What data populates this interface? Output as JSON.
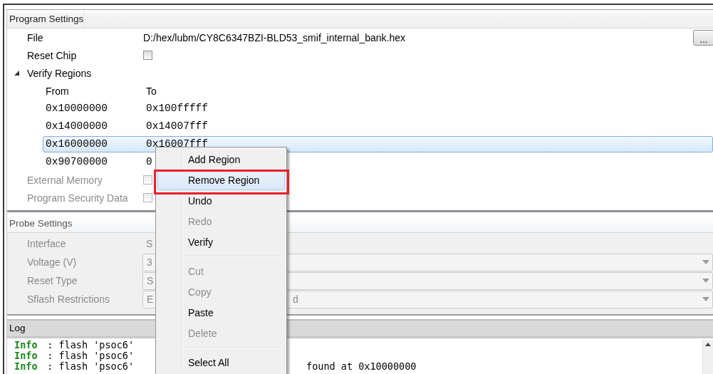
{
  "program_settings": {
    "title": "Program Settings",
    "file": {
      "label": "File",
      "value": "D:/hex/lubm/CY8C6347BZI-BLD53_smif_internal_bank.hex",
      "browse": "..."
    },
    "reset_chip": {
      "label": "Reset Chip",
      "checked": false
    },
    "verify_regions": {
      "label": "Verify Regions",
      "expanded": true,
      "columns": [
        "From",
        "To"
      ],
      "rows": [
        {
          "from": "0x10000000",
          "to": "0x100fffff",
          "selected": false
        },
        {
          "from": "0x14000000",
          "to": "0x14007fff",
          "selected": false
        },
        {
          "from": "0x16000000",
          "to": "0x16007fff",
          "selected": true
        },
        {
          "from": "0x90700000",
          "to": "0",
          "selected": false
        }
      ]
    },
    "external_memory": {
      "label": "External Memory",
      "checked": false,
      "disabled": true
    },
    "program_security_data": {
      "label": "Program Security Data",
      "checked": false,
      "disabled": true
    }
  },
  "probe_settings": {
    "title": "Probe Settings",
    "disabled": true,
    "rows": [
      {
        "label": "Interface",
        "kind": "text",
        "value": "S"
      },
      {
        "label": "Voltage (V)",
        "kind": "combo",
        "value": "3"
      },
      {
        "label": "Reset Type",
        "kind": "combo",
        "value": "S"
      },
      {
        "label": "Sflash Restrictions",
        "kind": "combo",
        "value": "E",
        "value_tail": "d"
      }
    ]
  },
  "log": {
    "title": "Log",
    "lines": [
      {
        "level": "Info",
        "message": ": flash 'psoc6'"
      },
      {
        "level": "Info",
        "message": ": flash 'psoc6'"
      },
      {
        "level": "Info",
        "message": ": flash 'psoc6'",
        "tail": "found at 0x10000000"
      }
    ]
  },
  "context_menu": {
    "items": [
      {
        "kind": "item",
        "label": "Add Region",
        "disabled": false,
        "selected": false,
        "callout": false
      },
      {
        "kind": "item",
        "label": "Remove Region",
        "disabled": false,
        "selected": true,
        "callout": true
      },
      {
        "kind": "item",
        "label": "Undo",
        "disabled": false,
        "selected": false,
        "callout": false
      },
      {
        "kind": "item",
        "label": "Redo",
        "disabled": true,
        "selected": false,
        "callout": false
      },
      {
        "kind": "item",
        "label": "Verify",
        "disabled": false,
        "selected": false,
        "callout": false
      },
      {
        "kind": "separator"
      },
      {
        "kind": "item",
        "label": "Cut",
        "disabled": true,
        "selected": false,
        "callout": false
      },
      {
        "kind": "item",
        "label": "Copy",
        "disabled": true,
        "selected": false,
        "callout": false
      },
      {
        "kind": "item",
        "label": "Paste",
        "disabled": false,
        "selected": false,
        "callout": false
      },
      {
        "kind": "item",
        "label": "Delete",
        "disabled": true,
        "selected": false,
        "callout": false
      },
      {
        "kind": "separator"
      },
      {
        "kind": "item",
        "label": "Select All",
        "disabled": false,
        "selected": false,
        "callout": false
      }
    ]
  }
}
